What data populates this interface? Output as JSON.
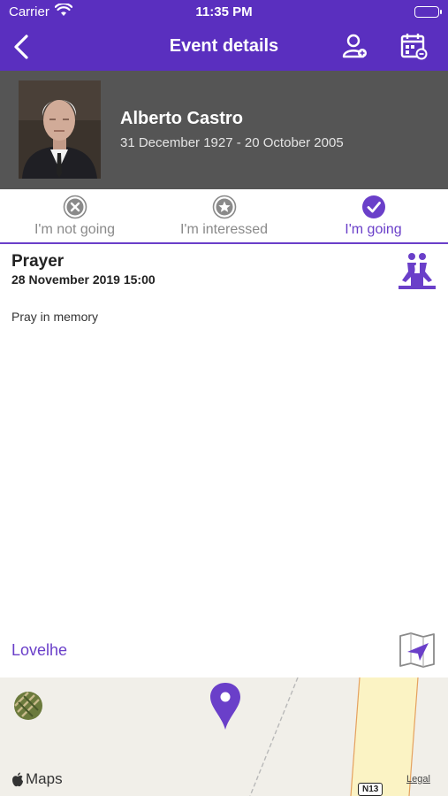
{
  "status_bar": {
    "carrier": "Carrier",
    "time": "11:35 PM",
    "wifi_icon": "wifi-icon",
    "battery_icon": "battery-icon"
  },
  "nav": {
    "title": "Event details",
    "back_icon": "chevron-left-icon",
    "right_icons": [
      "person-contact-icon",
      "calendar-edit-icon"
    ]
  },
  "profile": {
    "name": "Alberto Castro",
    "dates": "31 December 1927 - 20 October 2005",
    "photo_icon": "portrait-photo"
  },
  "rsvp": {
    "options": [
      {
        "label": "I'm not going",
        "icon": "x-circle-icon",
        "active": false
      },
      {
        "label": "I'm interessed",
        "icon": "star-circle-icon",
        "active": false
      },
      {
        "label": "I'm going",
        "icon": "check-circle-icon",
        "active": true
      }
    ]
  },
  "event": {
    "title": "Prayer",
    "datetime": "28 November 2019 15:00",
    "description": "Pray in memory",
    "type_icon": "prayer-icon"
  },
  "location": {
    "place": "Lovelhe",
    "directions_icon": "map-directions-icon"
  },
  "map": {
    "brand": "Maps",
    "legal": "Legal",
    "road_label": "N13",
    "pin_icon": "map-pin-icon",
    "satellite_icon": "satellite-toggle-icon"
  },
  "colors": {
    "accent": "#5a2fbf",
    "accent_light": "#6a3fc9",
    "profile_bg": "#555555"
  }
}
